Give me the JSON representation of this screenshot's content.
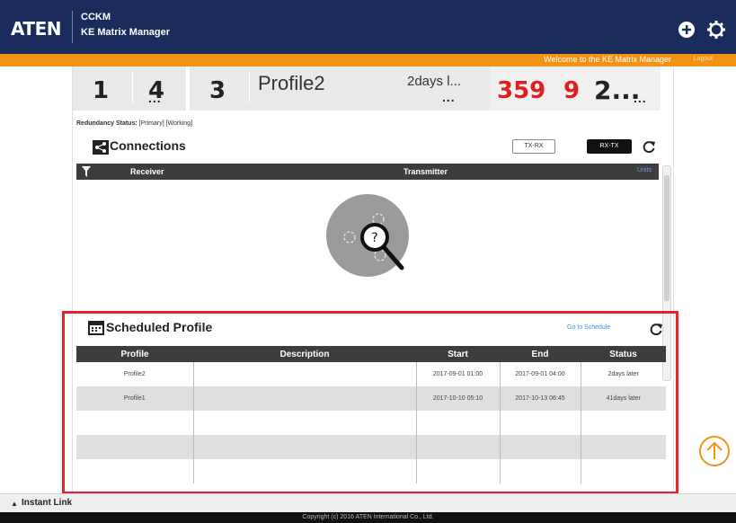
{
  "header": {
    "logo": "ATEN",
    "app_code": "CCKM",
    "app_name": "KE Matrix Manager",
    "add_icon": "plus-circle-icon",
    "settings_icon": "gear-icon"
  },
  "status_bar": {
    "welcome": "Welcome to the KE Matrix Manager",
    "logout": "Logout"
  },
  "stats": {
    "tile1_a": "1",
    "tile1_b": "4",
    "tile1_more": "...",
    "tile2_count": "3",
    "tile2_profile": "Profile2",
    "tile2_when": "2days l...",
    "tile2_more": "...",
    "tile3_a": "359",
    "tile3_b": "9",
    "tile3_c": "2...",
    "tile3_more": "..."
  },
  "redundancy": {
    "label": "Redundancy Status:",
    "value": "[Primary] [Working]"
  },
  "connections": {
    "title": "Connections",
    "btn_txrx": "TX-RX",
    "btn_rxtx": "RX-TX",
    "col_receiver": "Receiver",
    "col_transmitter": "Transmitter",
    "col_link": "Units"
  },
  "scheduled": {
    "title": "Scheduled Profile",
    "goto": "Go to Schedule",
    "columns": [
      "Profile",
      "Description",
      "Start",
      "End",
      "Status"
    ],
    "rows": [
      {
        "profile": "Profile2",
        "description": "",
        "start": "2017-09-01 01:00",
        "end": "2017-09-01 04:00",
        "status": "2days later"
      },
      {
        "profile": "Profile1",
        "description": "",
        "start": "2017-10-10 05:10",
        "end": "2017-10-13 06:45",
        "status": "41days later"
      }
    ]
  },
  "bottom": {
    "instant_link": "Instant Link",
    "copyright": "Copyright (c) 2016 ATEN International Co., Ltd."
  },
  "colors": {
    "header": "#1a2c5b",
    "accent_orange": "#f39316",
    "highlight_red": "#e3232d",
    "stat_red": "#e02020"
  }
}
